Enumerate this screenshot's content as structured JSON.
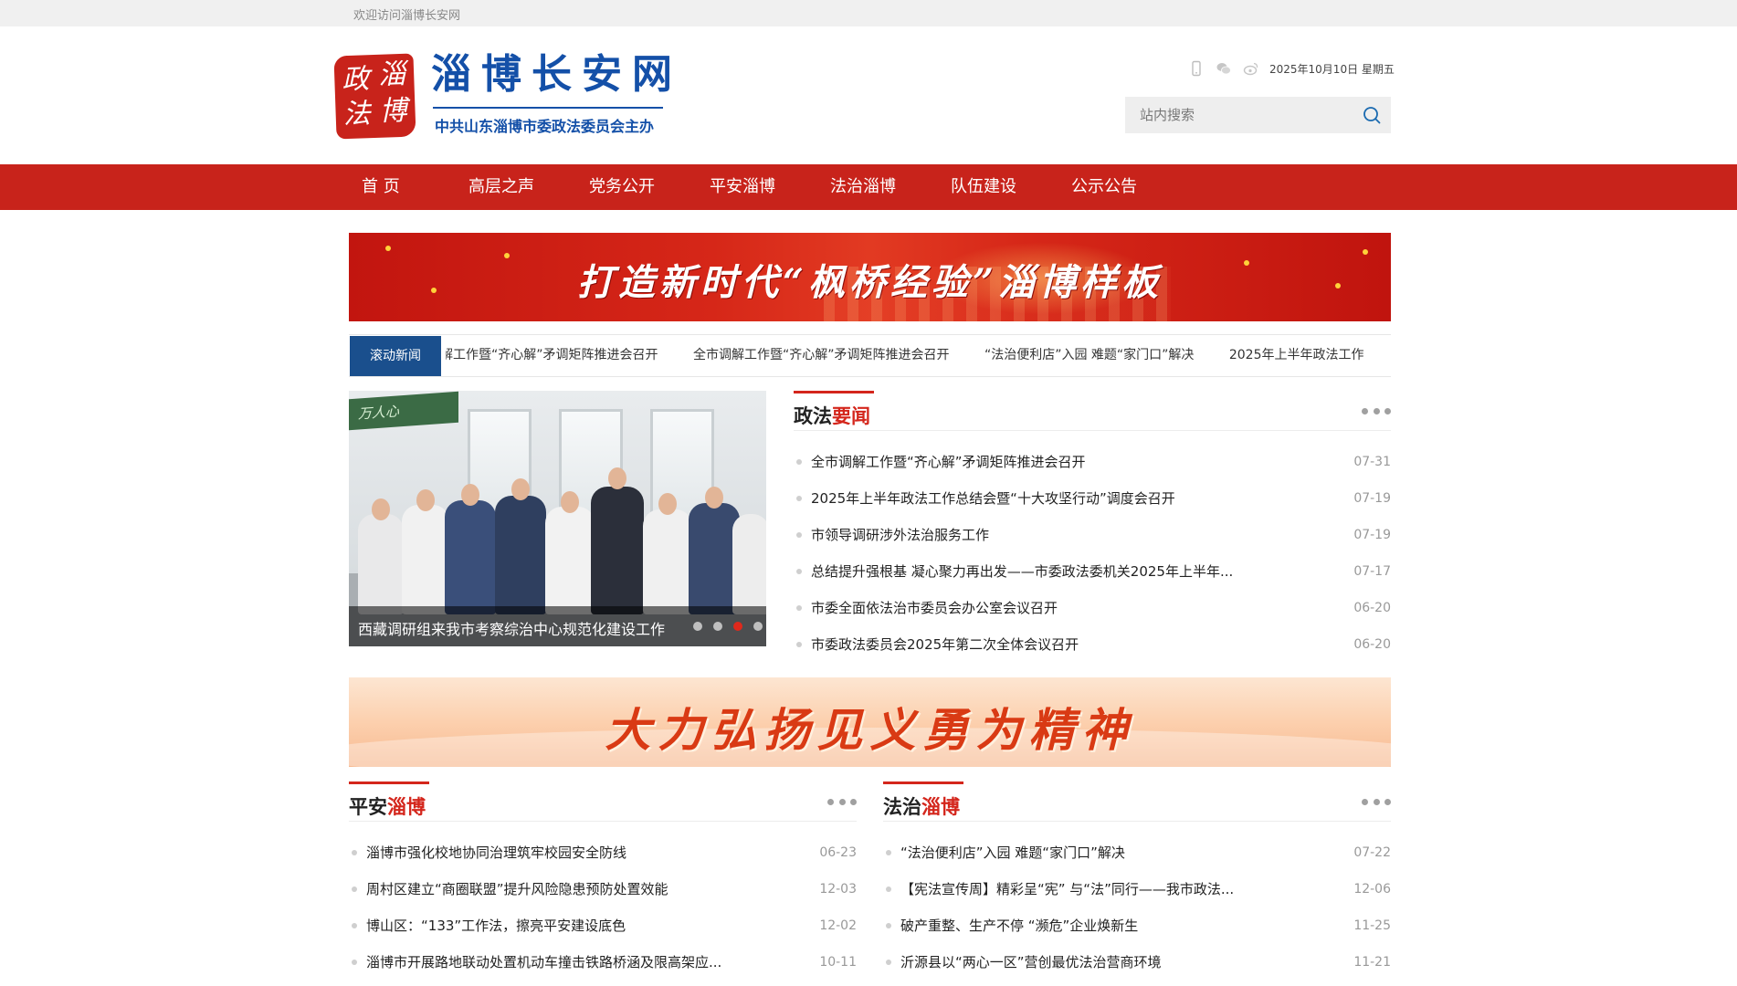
{
  "topbar": {
    "welcome": "欢迎访问淄博长安网"
  },
  "logo": {
    "seal_chars": [
      "淄",
      "博",
      "政",
      "法"
    ],
    "title": "淄博长安网",
    "subtitle": "中共山东淄博市委政法委员会主办"
  },
  "header": {
    "icons": [
      "mobile-icon",
      "wechat-icon",
      "weibo-icon"
    ],
    "date": "2025年10月10日 星期五"
  },
  "search": {
    "placeholder": "站内搜索"
  },
  "nav": {
    "items": [
      {
        "label": "首 页"
      },
      {
        "label": "高层之声"
      },
      {
        "label": "党务公开"
      },
      {
        "label": "平安淄博"
      },
      {
        "label": "法治淄博"
      },
      {
        "label": "队伍建设"
      },
      {
        "label": "公示公告"
      }
    ]
  },
  "banner1": {
    "slogan": "打造新时代“枫桥经验”淄博样板"
  },
  "ticker": {
    "label": "滚动新闻",
    "items": [
      "解工作暨“齐心解”矛调矩阵推进会召开",
      "全市调解工作暨“齐心解”矛调矩阵推进会召开",
      "“法治便利店”入园 难题“家门口”解决",
      "2025年上半年政法工作"
    ]
  },
  "slide": {
    "sign": "万人心",
    "caption": "西藏调研组来我市考察综治中心规范化建设工作",
    "dots": 4,
    "active_dot": 3
  },
  "news": {
    "title_a": "政法",
    "title_b": "要闻",
    "items": [
      {
        "title": "全市调解工作暨“齐心解”矛调矩阵推进会召开",
        "date": "07-31"
      },
      {
        "title": "2025年上半年政法工作总结会暨“十大攻坚行动”调度会召开",
        "date": "07-19"
      },
      {
        "title": "市领导调研涉外法治服务工作",
        "date": "07-19"
      },
      {
        "title": "总结提升强根基 凝心聚力再出发——市委政法委机关2025年上半年...",
        "date": "07-17"
      },
      {
        "title": "市委全面依法治市委员会办公室会议召开",
        "date": "06-20"
      },
      {
        "title": "市委政法委员会2025年第二次全体会议召开",
        "date": "06-20"
      }
    ]
  },
  "banner2": {
    "slogan": "大力弘扬见义勇为精神"
  },
  "pingan": {
    "title_a": "平安",
    "title_b": "淄博",
    "items": [
      {
        "title": "淄博市强化校地协同治理筑牢校园安全防线",
        "date": "06-23"
      },
      {
        "title": "周村区建立“商圈联盟”提升风险隐患预防处置效能",
        "date": "12-03"
      },
      {
        "title": "博山区：“133”工作法，擦亮平安建设底色",
        "date": "12-02"
      },
      {
        "title": "淄博市开展路地联动处置机动车撞击铁路桥涵及限高架应...",
        "date": "10-11"
      }
    ]
  },
  "fazhi": {
    "title_a": "法治",
    "title_b": "淄博",
    "items": [
      {
        "title": "“法治便利店”入园 难题“家门口”解决",
        "date": "07-22"
      },
      {
        "title": "【宪法宣传周】精彩呈“宪” 与“法”同行——我市政法...",
        "date": "12-06"
      },
      {
        "title": "破产重整、生产不停 “濒危”企业焕新生",
        "date": "11-25"
      },
      {
        "title": "沂源县以“两心一区”营创最优法治营商环境",
        "date": "11-21"
      }
    ]
  }
}
